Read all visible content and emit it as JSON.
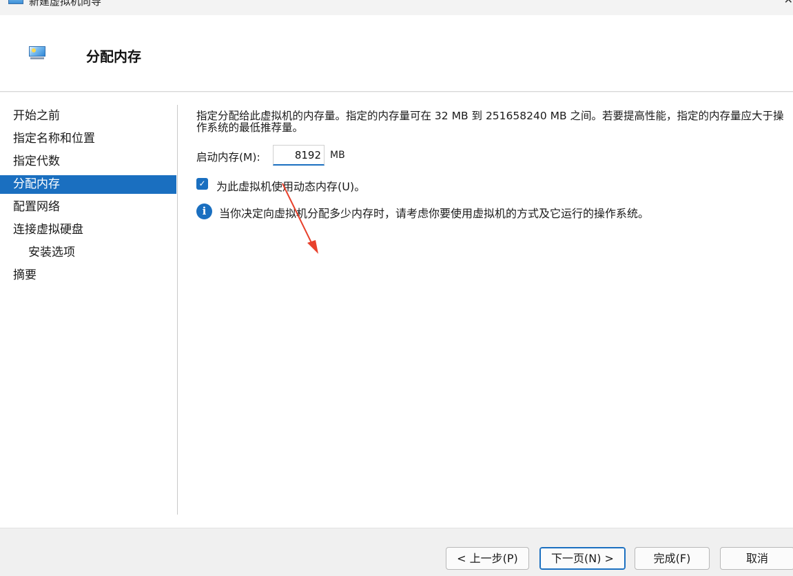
{
  "window": {
    "title": "新建虚拟机向导",
    "close_glyph": "✕"
  },
  "header": {
    "title": "分配内存",
    "icon": "monitor-icon"
  },
  "sidebar": {
    "items": [
      {
        "label": "开始之前"
      },
      {
        "label": "指定名称和位置"
      },
      {
        "label": "指定代数"
      },
      {
        "label": "分配内存",
        "active": true
      },
      {
        "label": "配置网络"
      },
      {
        "label": "连接虚拟硬盘"
      },
      {
        "label": "安装选项",
        "sub": true
      },
      {
        "label": "摘要"
      }
    ]
  },
  "main": {
    "description": "指定分配给此虚拟机的内存量。指定的内存量可在 32 MB 到 251658240 MB 之间。若要提高性能，指定的内存量应大于操作系统的最低推荐量。",
    "startup_memory_label": "启动内存(M):",
    "startup_memory_value": "8192",
    "startup_memory_unit": "MB",
    "dynamic_memory_label": "为此虚拟机使用动态内存(U)。",
    "dynamic_memory_checked": true,
    "info_text": "当你决定向虚拟机分配多少内存时，请考虑你要使用虚拟机的方式及它运行的操作系统。"
  },
  "footer": {
    "back_label": "< 上一步(P)",
    "next_label": "下一页(N) >",
    "finish_label": "完成(F)",
    "cancel_label": "取消"
  },
  "colors": {
    "accent": "#1a6fc0",
    "annotation_arrow": "#e8412c"
  }
}
